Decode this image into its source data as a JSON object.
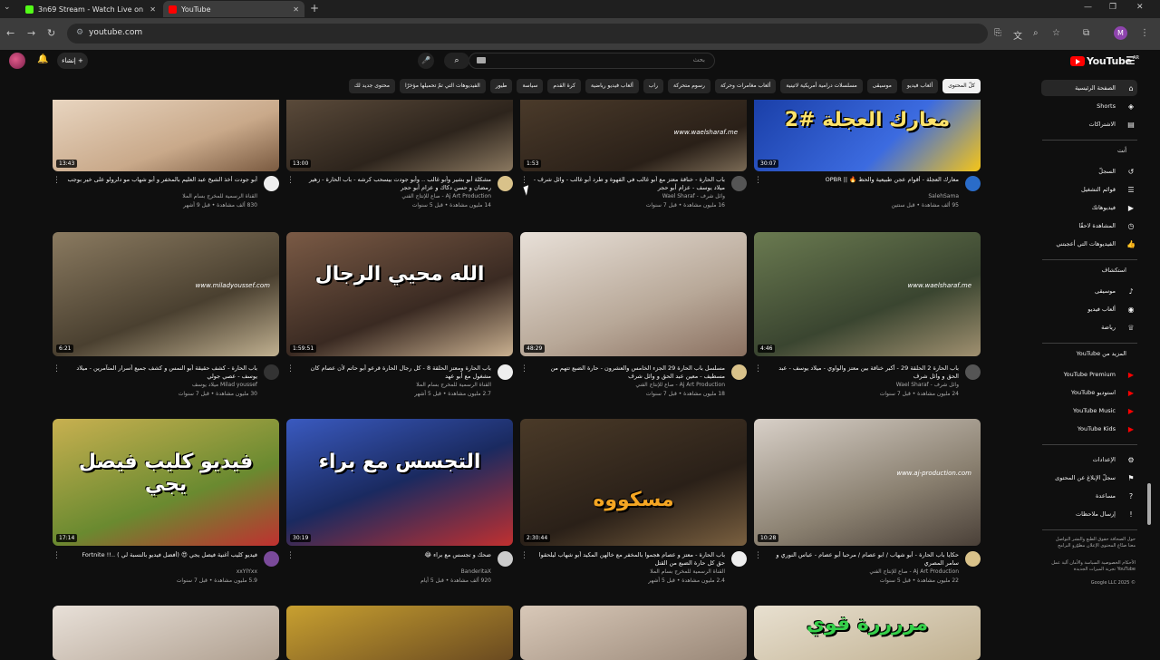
{
  "browser": {
    "tabs": [
      {
        "title": "3n69 Stream - Watch Live on K",
        "fav_color": "#53fc18",
        "active": false
      },
      {
        "title": "YouTube",
        "fav_color": "#ff0000",
        "active": true
      }
    ],
    "url": "youtube.com"
  },
  "masthead": {
    "logo_text": "YouTube",
    "logo_cc": "AR",
    "search_placeholder": "بحث",
    "create_label": "إنشاء"
  },
  "chips": [
    {
      "label": "كلّ المحتوى",
      "active": true
    },
    {
      "label": "ألعاب فيديو"
    },
    {
      "label": "موسيقى"
    },
    {
      "label": "مسلسلات درامية أمريكية لاتينية"
    },
    {
      "label": "ألعاب مغامرات وحركة"
    },
    {
      "label": "رسوم متحركة"
    },
    {
      "label": "راب"
    },
    {
      "label": "ألعاب فيديو رياضية"
    },
    {
      "label": "كرة القدم"
    },
    {
      "label": "سياسة"
    },
    {
      "label": "طيور"
    },
    {
      "label": "الفيديوهات التي تمّ تحميلها مؤخرًا"
    },
    {
      "label": "محتوى جديد لك"
    }
  ],
  "sidebar": {
    "main": [
      {
        "label": "الصفحة الرئيسية",
        "icon": "home-icon",
        "glyph": "⌂",
        "active": true
      },
      {
        "label": "Shorts",
        "icon": "shorts-icon",
        "glyph": "◈"
      },
      {
        "label": "الاشتراكات",
        "icon": "subscriptions-icon",
        "glyph": "▤"
      }
    ],
    "you_header": "أنت",
    "you": [
      {
        "label": "السجلّ",
        "icon": "history-icon",
        "glyph": "↺"
      },
      {
        "label": "قوائم التشغيل",
        "icon": "playlists-icon",
        "glyph": "☰"
      },
      {
        "label": "فيديوهاتك",
        "icon": "your-videos-icon",
        "glyph": "▶"
      },
      {
        "label": "المشاهدة لاحقًا",
        "icon": "watch-later-icon",
        "glyph": "◷"
      },
      {
        "label": "الفيديوهات التي أعجبتني",
        "icon": "like-icon",
        "glyph": "👍"
      }
    ],
    "explore_header": "استكشاف",
    "explore": [
      {
        "label": "موسيقى",
        "icon": "music-icon",
        "glyph": "♪"
      },
      {
        "label": "ألعاب فيديو",
        "icon": "gaming-icon",
        "glyph": "◉"
      },
      {
        "label": "رياضة",
        "icon": "trophy-icon",
        "glyph": "♕"
      }
    ],
    "more_header": "المزيد من YouTube",
    "more": [
      {
        "label": "YouTube Premium",
        "icon": "yt-premium-icon"
      },
      {
        "label": "استوديو YouTube",
        "icon": "yt-studio-icon"
      },
      {
        "label": "YouTube Music",
        "icon": "yt-music-icon"
      },
      {
        "label": "YouTube Kids",
        "icon": "yt-kids-icon"
      }
    ],
    "settings": [
      {
        "label": "الإعدادات",
        "icon": "settings-icon",
        "glyph": "⚙"
      },
      {
        "label": "سجلّ الإبلاغ عن المحتوى",
        "icon": "flag-icon",
        "glyph": "⚑"
      },
      {
        "label": "مساعدة",
        "icon": "help-icon",
        "glyph": "?"
      },
      {
        "label": "إرسال ملاحظات",
        "icon": "feedback-icon",
        "glyph": "!"
      }
    ],
    "footer1": "حول  الصحافة  حقوق الطبع والنشر  التواصل معنا  صنّاع المحتوى  الإعلان  مطوّرو البرامج",
    "footer2": "الأحكام  الخصوصية  السياسة والأمان  آلية عمل YouTube  تجربة الميزات الجديدة",
    "copyright": "© 2025 Google LLC"
  },
  "videos": [
    {
      "title": "معارك العجلة - أقوام عجن طبيعية والحظ 🔥 || OPBR",
      "channel": "SalehSama",
      "stats": "95 ألف مشاهدة • قبل سنتين",
      "duration": "30:07",
      "overlay": "معارك العجلة #2",
      "bg": "linear-gradient(135deg,#1a3fa8,#3c6be0 60%,#f5c518)",
      "av": "#2a6cc9"
    },
    {
      "title": "باب الحارة - خناقة معتز مع أبو غالب في القهوة و طرد أبو غالب - وائل شرف - ميلاد يوسف - عزام أبو حجر",
      "channel": "وائل شرف - Wael Sharaf",
      "stats": "16 مليون مشاهدة • قبل 7 سنوات",
      "duration": "1:53",
      "overlay": "www.waelsharaf.me",
      "bg": "linear-gradient(160deg,#4a3a2a,#2a2018 70%,#7a6a55)",
      "av": "#555"
    },
    {
      "title": "مشكلة أبو بشير وأبو غالب .. وأبو جودت بيسحب كرشه - باب الحارة - زهير رمضان و حسن دكاك و عزام أبو حجر",
      "channel": "Aj Art Production - صاع للإنتاج الفني",
      "stats": "14 مليون مشاهدة • قبل 5 سنوات",
      "duration": "13:00",
      "overlay": "",
      "bg": "linear-gradient(160deg,#5a4a3a,#2d241c 60%,#8a7860)",
      "av": "#d9c28a"
    },
    {
      "title": "أبو جودت أخذ الشيخ عبد العليم بالمخفر و أبو شهاب مو دلرولو على خير بوجب",
      "channel": "القناة الرسمية للمخرج بسام الملا",
      "stats": "830 ألف مشاهدة • قبل 9 أشهر",
      "duration": "13:43",
      "overlay": "",
      "bg": "linear-gradient(160deg,#e8d5c0,#c9a98a 60%,#7a5a40)",
      "av": "#eee"
    },
    {
      "title": "باب الحارة 2 الحلقة 29 - أكبر خناقة بين معتز والواوي - ميلاد يوسف - عبد الحق و وائل شرف",
      "channel": "وائل شرف - Wael Sharaf",
      "stats": "24 مليون مشاهدة • قبل 7 سنوات",
      "duration": "4:46",
      "overlay": "www.waelsharaf.me",
      "bg": "linear-gradient(160deg,#6a7a50,#3a4530 60%,#a09070)",
      "av": "#555"
    },
    {
      "title": "مسلسل باب الحارة 29 الجزء الخامس والعشرون - حارة الضبع تتهم من مسطيف - معين عبد الحق و وائل شرف",
      "channel": "Aj Art Production - صاع للإنتاج الفني",
      "stats": "18 مليون مشاهدة • قبل 7 سنوات",
      "duration": "48:29",
      "overlay": "",
      "bg": "linear-gradient(160deg,#e8e0d8,#b8a898 60%,#8a7060)",
      "av": "#d9c28a"
    },
    {
      "title": "باب الحارة ومعتز الحلقة 8 - كل رجال الحارة قرعو أبو حاتم لأن عصام كان مشغول مع أبو عهد",
      "channel": "القناة الرسمية للمخرج بسام الملا",
      "stats": "2.7 مليون مشاهدة • قبل 5 أشهر",
      "duration": "1:59:51",
      "overlay": "الله محيي الرجال",
      "bg": "linear-gradient(160deg,#7a5a45,#3a2a22 60%,#c9b090)",
      "av": "#eee"
    },
    {
      "title": "باب الحارة - كشف حقيقة أبو النمس و كشف جميع أسرار المتآمرين - ميلاد يوسف - عصي جولي",
      "channel": "Milad youssef ميلاد يوسف",
      "stats": "30 مليون مشاهدة • قبل 7 سنوات",
      "duration": "6:21",
      "overlay": "www.miladyoussef.com",
      "bg": "linear-gradient(160deg,#8a7a60,#4a4030 60%,#c0b090)",
      "av": "#333"
    },
    {
      "title": "حكايا باب الحارة - أبو شهاب / ابو عصام / مرحبا أبو عصام - عباس النوري و سامر المصري",
      "channel": "Aj Art Production - صاع للإنتاج الفني",
      "stats": "22 مليون مشاهدة • قبل 5 سنوات",
      "duration": "10:28",
      "overlay": "www.aj-production.com",
      "bg": "linear-gradient(160deg,#d8d0c8,#8a8070 60%,#4a4038)",
      "av": "#d9c28a"
    },
    {
      "title": "باب الحارة - معتز و عصام هجموا بالمخفر مع خالهن المكيد أبو شهاب ليلحقوا حق كل حارة الضبع من القتل",
      "channel": "القناة الرسمية للمخرج بسام الملا",
      "stats": "2.4 مليون مشاهدة • قبل 5 أشهر",
      "duration": "2:30:44",
      "overlay": "مسكووه",
      "bg": "linear-gradient(160deg,#4a3a28,#2a2018 60%,#7a6040)",
      "av": "#eee"
    },
    {
      "title": "ضحك و تجسس مع براء 😂",
      "channel": "BanderitaX",
      "stats": "920 ألف مشاهدة • قبل 5 أيام",
      "duration": "30:19",
      "overlay": "التجسس مع براء",
      "bg": "linear-gradient(160deg,#3a5ac0,#1a2a60 50%,#c03030)",
      "av": "#ccc"
    },
    {
      "title": "فيديو كليب أغنية فيصل يجي 😍 (أفضل فيديو بالنسبة لي ) ..!! Fortnite",
      "channel": "xxYIYxx",
      "stats": "5.9 مليون مشاهدة • قبل 7 سنوات",
      "duration": "17:14",
      "overlay": "فيديو كليب فيصل يجي",
      "bg": "linear-gradient(160deg,#c8b050,#6a8a30 60%,#c03030)",
      "av": "#7a4a9a"
    },
    {
      "title": "",
      "channel": "",
      "stats": "",
      "duration": "",
      "overlay": "مررررة قوي",
      "bg": "linear-gradient(160deg,#e8e0d0,#c0b090)",
      "av": "#555"
    },
    {
      "title": "",
      "channel": "",
      "stats": "",
      "duration": "",
      "overlay": "",
      "bg": "linear-gradient(160deg,#d8c8b8,#9a8878)",
      "av": "#555"
    },
    {
      "title": "",
      "channel": "",
      "stats": "",
      "duration": "",
      "overlay": "",
      "bg": "linear-gradient(160deg,#c8a030,#6a4a20)",
      "av": "#555"
    },
    {
      "title": "",
      "channel": "",
      "stats": "",
      "duration": "",
      "overlay": "",
      "bg": "linear-gradient(160deg,#e8e0d8,#b0a090)",
      "av": "#555"
    }
  ],
  "colors": {
    "accent": "#ff0000",
    "background": "#0f0f0f",
    "chip_bg": "#272727"
  }
}
